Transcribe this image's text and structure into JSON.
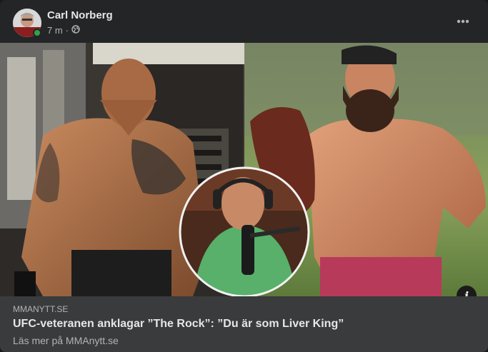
{
  "post": {
    "author": "Carl Norberg",
    "time": "7 m",
    "separator": "·",
    "privacy_icon": "globe-icon",
    "more_icon": "more-horizontal-icon"
  },
  "media": {
    "info_label": "i"
  },
  "link_preview": {
    "domain": "MMANYTT.SE",
    "headline": "UFC-veteranen anklagar ”The Rock”: ”Du är som Liver King”",
    "subline": "Läs mer på MMAnytt.se"
  },
  "colors": {
    "card": "#242526",
    "preview": "#3a3b3c",
    "primary_text": "#e4e6eb",
    "secondary_text": "#b0b3b8",
    "online": "#31a24c"
  }
}
